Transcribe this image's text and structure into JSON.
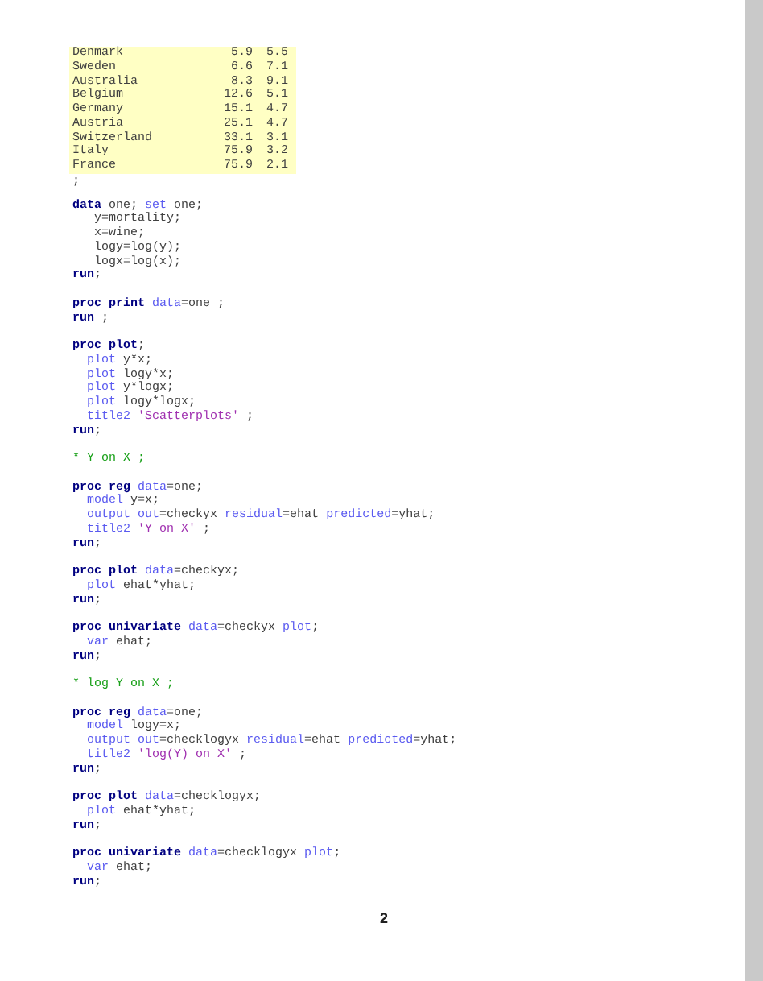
{
  "data_table": {
    "rows": [
      {
        "cells": [
          "Denmark",
          "5.9",
          "5.5"
        ]
      },
      {
        "cells": [
          "Sweden",
          "6.6",
          "7.1"
        ]
      },
      {
        "cells": [
          "Australia",
          "8.3",
          "9.1"
        ]
      },
      {
        "cells": [
          "Belgium",
          "12.6",
          "5.1"
        ]
      },
      {
        "cells": [
          "Germany",
          "15.1",
          "4.7"
        ]
      },
      {
        "cells": [
          "Austria",
          "25.1",
          "4.7"
        ]
      },
      {
        "cells": [
          "Switzerland",
          "33.1",
          "3.1"
        ]
      },
      {
        "cells": [
          "Italy",
          "75.9",
          "3.2"
        ]
      },
      {
        "cells": [
          "France",
          "75.9",
          "2.1"
        ]
      }
    ]
  },
  "table_terminator": ";",
  "code_lines": [
    {
      "kind": "code",
      "tokens": [
        {
          "kind": "keyword",
          "text": "data"
        },
        {
          "kind": "plain",
          "text": " one; "
        },
        {
          "kind": "option",
          "text": "set"
        },
        {
          "kind": "plain",
          "text": " one;"
        }
      ]
    },
    {
      "kind": "code",
      "tokens": [
        {
          "kind": "plain",
          "text": "   y=mortality;"
        }
      ]
    },
    {
      "kind": "code",
      "tokens": [
        {
          "kind": "plain",
          "text": "   x=wine;"
        }
      ]
    },
    {
      "kind": "code",
      "tokens": [
        {
          "kind": "plain",
          "text": "   logy=log(y);"
        }
      ]
    },
    {
      "kind": "code",
      "tokens": [
        {
          "kind": "plain",
          "text": "   logx=log(x);"
        }
      ]
    },
    {
      "kind": "code",
      "tokens": [
        {
          "kind": "keyword",
          "text": "run"
        },
        {
          "kind": "plain",
          "text": ";"
        }
      ]
    },
    {
      "kind": "blank"
    },
    {
      "kind": "code",
      "tokens": [
        {
          "kind": "keyword",
          "text": "proc print"
        },
        {
          "kind": "option",
          "text": " data"
        },
        {
          "kind": "plain",
          "text": "=one ;"
        }
      ]
    },
    {
      "kind": "code",
      "tokens": [
        {
          "kind": "keyword",
          "text": "run"
        },
        {
          "kind": "plain",
          "text": " ;"
        }
      ]
    },
    {
      "kind": "blank"
    },
    {
      "kind": "code",
      "tokens": [
        {
          "kind": "keyword",
          "text": "proc plot"
        },
        {
          "kind": "plain",
          "text": ";"
        }
      ]
    },
    {
      "kind": "code",
      "tokens": [
        {
          "kind": "option",
          "text": "  plot"
        },
        {
          "kind": "plain",
          "text": " y*x;"
        }
      ]
    },
    {
      "kind": "code",
      "tokens": [
        {
          "kind": "option",
          "text": "  plot"
        },
        {
          "kind": "plain",
          "text": " logy*x;"
        }
      ]
    },
    {
      "kind": "code",
      "tokens": [
        {
          "kind": "option",
          "text": "  plot"
        },
        {
          "kind": "plain",
          "text": " y*logx;"
        }
      ]
    },
    {
      "kind": "code",
      "tokens": [
        {
          "kind": "option",
          "text": "  plot"
        },
        {
          "kind": "plain",
          "text": " logy*logx;"
        }
      ]
    },
    {
      "kind": "code",
      "tokens": [
        {
          "kind": "option",
          "text": "  title2"
        },
        {
          "kind": "string",
          "text": " 'Scatterplots'"
        },
        {
          "kind": "plain",
          "text": " ;"
        }
      ]
    },
    {
      "kind": "code",
      "tokens": [
        {
          "kind": "keyword",
          "text": "run"
        },
        {
          "kind": "plain",
          "text": ";"
        }
      ]
    },
    {
      "kind": "blank"
    },
    {
      "kind": "code",
      "tokens": [
        {
          "kind": "comment",
          "text": "* Y on X ;"
        }
      ]
    },
    {
      "kind": "blank"
    },
    {
      "kind": "code",
      "tokens": [
        {
          "kind": "keyword",
          "text": "proc reg"
        },
        {
          "kind": "option",
          "text": " data"
        },
        {
          "kind": "plain",
          "text": "=one;"
        }
      ]
    },
    {
      "kind": "code",
      "tokens": [
        {
          "kind": "option",
          "text": "  model"
        },
        {
          "kind": "plain",
          "text": " y=x;"
        }
      ]
    },
    {
      "kind": "code",
      "tokens": [
        {
          "kind": "option",
          "text": "  output out"
        },
        {
          "kind": "plain",
          "text": "=checkyx "
        },
        {
          "kind": "option",
          "text": "residual"
        },
        {
          "kind": "plain",
          "text": "=ehat "
        },
        {
          "kind": "option",
          "text": "predicted"
        },
        {
          "kind": "plain",
          "text": "=yhat;"
        }
      ]
    },
    {
      "kind": "code",
      "tokens": [
        {
          "kind": "option",
          "text": "  title2"
        },
        {
          "kind": "string",
          "text": " 'Y on X'"
        },
        {
          "kind": "plain",
          "text": " ;"
        }
      ]
    },
    {
      "kind": "code",
      "tokens": [
        {
          "kind": "keyword",
          "text": "run"
        },
        {
          "kind": "plain",
          "text": ";"
        }
      ]
    },
    {
      "kind": "blank"
    },
    {
      "kind": "code",
      "tokens": [
        {
          "kind": "keyword",
          "text": "proc plot"
        },
        {
          "kind": "option",
          "text": " data"
        },
        {
          "kind": "plain",
          "text": "=checkyx;"
        }
      ]
    },
    {
      "kind": "code",
      "tokens": [
        {
          "kind": "option",
          "text": "  plot"
        },
        {
          "kind": "plain",
          "text": " ehat*yhat;"
        }
      ]
    },
    {
      "kind": "code",
      "tokens": [
        {
          "kind": "keyword",
          "text": "run"
        },
        {
          "kind": "plain",
          "text": ";"
        }
      ]
    },
    {
      "kind": "blank"
    },
    {
      "kind": "code",
      "tokens": [
        {
          "kind": "keyword",
          "text": "proc univariate"
        },
        {
          "kind": "option",
          "text": " data"
        },
        {
          "kind": "plain",
          "text": "=checkyx "
        },
        {
          "kind": "option",
          "text": "plot"
        },
        {
          "kind": "plain",
          "text": ";"
        }
      ]
    },
    {
      "kind": "code",
      "tokens": [
        {
          "kind": "option",
          "text": "  var"
        },
        {
          "kind": "plain",
          "text": " ehat;"
        }
      ]
    },
    {
      "kind": "code",
      "tokens": [
        {
          "kind": "keyword",
          "text": "run"
        },
        {
          "kind": "plain",
          "text": ";"
        }
      ]
    },
    {
      "kind": "blank"
    },
    {
      "kind": "code",
      "tokens": [
        {
          "kind": "comment",
          "text": "* log Y on X ;"
        }
      ]
    },
    {
      "kind": "blank"
    },
    {
      "kind": "code",
      "tokens": [
        {
          "kind": "keyword",
          "text": "proc reg"
        },
        {
          "kind": "option",
          "text": " data"
        },
        {
          "kind": "plain",
          "text": "=one;"
        }
      ]
    },
    {
      "kind": "code",
      "tokens": [
        {
          "kind": "option",
          "text": "  model"
        },
        {
          "kind": "plain",
          "text": " logy=x;"
        }
      ]
    },
    {
      "kind": "code",
      "tokens": [
        {
          "kind": "option",
          "text": "  output out"
        },
        {
          "kind": "plain",
          "text": "=checklogyx "
        },
        {
          "kind": "option",
          "text": "residual"
        },
        {
          "kind": "plain",
          "text": "=ehat "
        },
        {
          "kind": "option",
          "text": "predicted"
        },
        {
          "kind": "plain",
          "text": "=yhat;"
        }
      ]
    },
    {
      "kind": "code",
      "tokens": [
        {
          "kind": "option",
          "text": "  title2"
        },
        {
          "kind": "string",
          "text": " 'log(Y) on X'"
        },
        {
          "kind": "plain",
          "text": " ;"
        }
      ]
    },
    {
      "kind": "code",
      "tokens": [
        {
          "kind": "keyword",
          "text": "run"
        },
        {
          "kind": "plain",
          "text": ";"
        }
      ]
    },
    {
      "kind": "blank"
    },
    {
      "kind": "code",
      "tokens": [
        {
          "kind": "keyword",
          "text": "proc plot"
        },
        {
          "kind": "option",
          "text": " data"
        },
        {
          "kind": "plain",
          "text": "=checklogyx;"
        }
      ]
    },
    {
      "kind": "code",
      "tokens": [
        {
          "kind": "option",
          "text": "  plot"
        },
        {
          "kind": "plain",
          "text": " ehat*yhat;"
        }
      ]
    },
    {
      "kind": "code",
      "tokens": [
        {
          "kind": "keyword",
          "text": "run"
        },
        {
          "kind": "plain",
          "text": ";"
        }
      ]
    },
    {
      "kind": "blank"
    },
    {
      "kind": "code",
      "tokens": [
        {
          "kind": "keyword",
          "text": "proc univariate"
        },
        {
          "kind": "option",
          "text": " data"
        },
        {
          "kind": "plain",
          "text": "=checklogyx "
        },
        {
          "kind": "option",
          "text": "plot"
        },
        {
          "kind": "plain",
          "text": ";"
        }
      ]
    },
    {
      "kind": "code",
      "tokens": [
        {
          "kind": "option",
          "text": "  var"
        },
        {
          "kind": "plain",
          "text": " ehat;"
        }
      ]
    },
    {
      "kind": "code",
      "tokens": [
        {
          "kind": "keyword",
          "text": "run"
        },
        {
          "kind": "plain",
          "text": ";"
        }
      ]
    }
  ],
  "page_number": "2"
}
